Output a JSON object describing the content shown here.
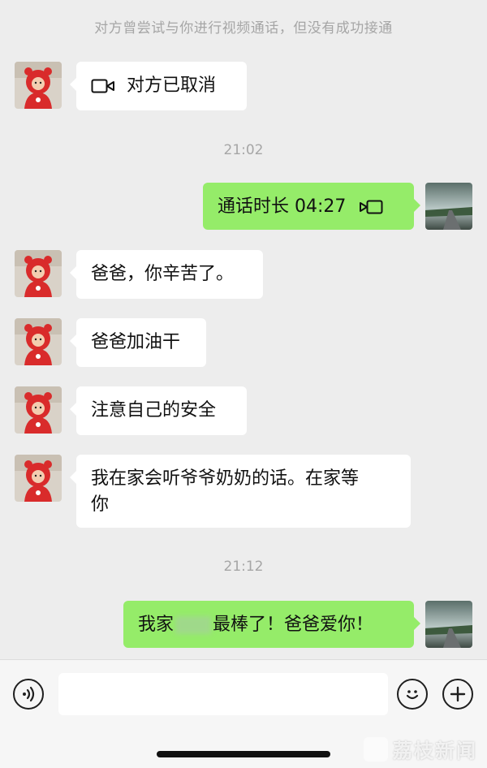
{
  "system_notice": "对方曾尝试与你进行视频通话，但没有成功接通",
  "messages": {
    "cancelled_call": {
      "text": "对方已取消",
      "icon": "video-camera-icon"
    },
    "time_1": "21:02",
    "call_duration": {
      "text": "通话时长 04:27",
      "icon": "video-camera-icon"
    },
    "msg_1": "爸爸，你辛苦了。",
    "msg_2": "爸爸加油干",
    "msg_3": "注意自己的安全",
    "msg_4_line_1": "我在家会听爷爷奶奶的话。在家等",
    "msg_4_line_2": "你",
    "time_2": "21:12",
    "msg_5_prefix": "我家",
    "msg_5_suffix": "最棒了！爸爸爱你！"
  },
  "input_bar": {
    "voice_icon": "voice-icon",
    "emoji_icon": "emoji-icon",
    "plus_icon": "plus-icon",
    "placeholder": ""
  },
  "watermark": "荔枝新闻",
  "colors": {
    "background": "#ededed",
    "bubble_incoming": "#ffffff",
    "bubble_outgoing": "#95ec69",
    "timestamp": "#a6a6a6"
  }
}
